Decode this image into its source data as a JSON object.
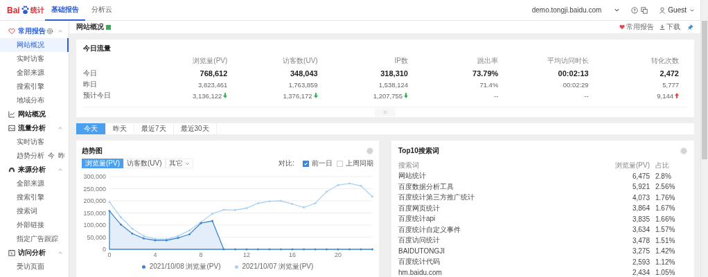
{
  "header": {
    "logo": {
      "latin": "Bai",
      "cjk": "统计"
    },
    "tabs": [
      {
        "label": "基础报告",
        "selected": true
      },
      {
        "label": "分析云",
        "selected": false
      }
    ],
    "site": "demo.tongji.baidu.com",
    "user": "Guest"
  },
  "sidebar": {
    "groups": [
      {
        "label": "常用报告",
        "expanded": true,
        "settings": true,
        "items": [
          {
            "label": "网站概况",
            "selected": true
          },
          {
            "label": "实时访客",
            "selected": false
          },
          {
            "label": "全部来源",
            "selected": false
          },
          {
            "label": "搜索引擎",
            "selected": false
          },
          {
            "label": "地域分布",
            "selected": false
          }
        ]
      },
      {
        "label": "网站概况",
        "settings": false
      },
      {
        "label": "流量分析",
        "expanded": true,
        "settings": false,
        "items": [
          {
            "label": "实时访客",
            "selected": false
          },
          {
            "label": "趋势分析",
            "selected": false,
            "tags": [
              "今",
              "昨"
            ]
          }
        ]
      },
      {
        "label": "来源分析",
        "expanded": true,
        "settings": false,
        "items": [
          {
            "label": "全部来源",
            "selected": false
          },
          {
            "label": "搜索引擎",
            "selected": false
          },
          {
            "label": "搜索词",
            "selected": false
          },
          {
            "label": "外部链接",
            "selected": false
          },
          {
            "label": "指定广告跟踪",
            "selected": false
          }
        ]
      },
      {
        "label": "访问分析",
        "expanded": true,
        "settings": false,
        "items": [
          {
            "label": "受访页面",
            "selected": false
          }
        ]
      }
    ]
  },
  "page": {
    "title": "网站概况",
    "actions": [
      "常用报告",
      "下载"
    ]
  },
  "today": {
    "title": "今日流量",
    "columns": [
      "浏览量(PV)",
      "访客数(UV)",
      "IP数",
      "跳出率",
      "平均访问时长",
      "转化次数"
    ],
    "rows": [
      {
        "label": "今日",
        "kind": "main",
        "cells": [
          {
            "text": "768,612"
          },
          {
            "text": "348,043"
          },
          {
            "text": "318,310"
          },
          {
            "text": "73.79%"
          },
          {
            "text": "00:02:13"
          },
          {
            "text": "2,472"
          }
        ]
      },
      {
        "label": "昨日",
        "kind": "plain",
        "cells": [
          {
            "text": "3,823,461"
          },
          {
            "text": "1,763,859"
          },
          {
            "text": "1,538,124"
          },
          {
            "text": "71.4%"
          },
          {
            "text": "00:02:29"
          },
          {
            "text": "5,777"
          }
        ]
      },
      {
        "label": "预计今日",
        "kind": "plain",
        "cells": [
          {
            "text": "3,136,122",
            "rising": false
          },
          {
            "text": "1,376,172",
            "rising": false
          },
          {
            "text": "1,207,755",
            "rising": false
          },
          {
            "text": "--"
          },
          {
            "text": "--"
          },
          {
            "text": "9,144",
            "rising": true
          }
        ]
      }
    ]
  },
  "ranges": [
    {
      "label": "今天",
      "selected": true
    },
    {
      "label": "昨天",
      "selected": false
    },
    {
      "label": "最近7天",
      "selected": false
    },
    {
      "label": "最近30天",
      "selected": false
    }
  ],
  "trend": {
    "title": "趋势图",
    "metrics": [
      {
        "label": "浏览量(PV)",
        "selected": true
      },
      {
        "label": "访客数(UV)",
        "selected": false
      },
      {
        "label": "其它",
        "selected": false
      }
    ],
    "compare_label": "对比:",
    "compare": [
      {
        "label": "前一日",
        "checked": true
      },
      {
        "label": "上周同期",
        "checked": false
      }
    ],
    "chart_data": {
      "type": "line",
      "x": [
        0,
        1,
        2,
        3,
        4,
        5,
        6,
        7,
        8,
        9,
        10,
        11,
        12,
        13,
        14,
        15,
        16,
        17,
        18,
        19,
        20,
        21,
        22,
        23
      ],
      "grid": true,
      "xticks": [
        0,
        4,
        8,
        12,
        16,
        20
      ],
      "xlim": [
        0,
        23
      ],
      "ylim": [
        0,
        300000
      ],
      "yticks": [
        {
          "value": 0,
          "label": "0"
        },
        {
          "value": 50000,
          "label": "50,000"
        },
        {
          "value": 100000,
          "label": "100,000"
        },
        {
          "value": 150000,
          "label": "150,000"
        },
        {
          "value": 200000,
          "label": "200,000"
        },
        {
          "value": 250000,
          "label": "250,000"
        },
        {
          "value": 300000,
          "label": "300,000"
        }
      ],
      "series": [
        {
          "name": "2021/10/08 浏览量(PV)",
          "type": "area",
          "color": "#3c86d6",
          "values": [
            158000,
            102000,
            65000,
            45000,
            37000,
            37000,
            47000,
            62000,
            108000,
            117000,
            0,
            0,
            0,
            0,
            0,
            0,
            0,
            0,
            0,
            0,
            0,
            0,
            0,
            0
          ]
        },
        {
          "name": "2021/10/07 浏览量(PV)",
          "type": "line",
          "color": "#a9d2f2",
          "values": [
            195000,
            132000,
            85000,
            55000,
            43000,
            42000,
            55000,
            78000,
            112000,
            147000,
            163000,
            162000,
            170000,
            190000,
            198000,
            200000,
            187000,
            173000,
            190000,
            238000,
            265000,
            272000,
            262000,
            218000
          ]
        }
      ]
    }
  },
  "top10": {
    "title": "Top10搜索词",
    "columns": [
      "搜索词",
      "浏览量(PV)",
      "占比"
    ],
    "rows": [
      [
        "网站统计",
        "6,475",
        "2.8%"
      ],
      [
        "百度数据分析工具",
        "5,921",
        "2.56%"
      ],
      [
        "百度统计第三方推广统计",
        "4,073",
        "1.76%"
      ],
      [
        "百度网页统计",
        "3,864",
        "1.67%"
      ],
      [
        "百度统计api",
        "3,835",
        "1.66%"
      ],
      [
        "百度统计自定义事件",
        "3,634",
        "1.57%"
      ],
      [
        "百度访问统计",
        "3,478",
        "1.51%"
      ],
      [
        "BAIDUTONGJI",
        "3,275",
        "1.42%"
      ],
      [
        "百度统计代码",
        "2,593",
        "1.12%"
      ],
      [
        "hm.baidu.com",
        "2,434",
        "1.05%"
      ]
    ]
  }
}
